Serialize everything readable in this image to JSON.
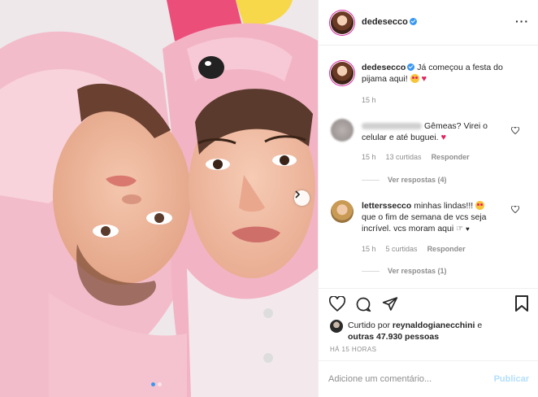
{
  "post": {
    "dots": 2,
    "active_dot": 0
  },
  "header": {
    "username": "dedesecco",
    "more_icon": "more-horizontal-icon"
  },
  "caption": {
    "username": "dedesecco",
    "text": "Já começou a festa do pijama aqui!",
    "time": "15 h"
  },
  "comments": [
    {
      "text": "Gêmeas? Virei o celular e até buguei.",
      "time": "15 h",
      "likes": "13 curtidas",
      "reply": "Responder",
      "view_replies": "Ver respostas (4)"
    },
    {
      "username": "letterssecco",
      "text_line1": "minhas lindas!!!",
      "text_line2": "que o fim de semana de vcs seja",
      "text_line3": "incrível. vcs moram aqui",
      "time": "15 h",
      "likes": "5 curtidas",
      "reply": "Responder",
      "view_replies": "Ver respostas (1)"
    }
  ],
  "likes": {
    "prefix": "Curtido por",
    "user": "reynaldogianecchini",
    "mid": "e",
    "others": "outras 47.930 pessoas"
  },
  "ago": "HÁ 15 HORAS",
  "add_comment": {
    "placeholder": "Adicione um comentário...",
    "publish": "Publicar"
  },
  "colors": {
    "accent": "#3897f0",
    "publish_disabled": "#b2dffc",
    "muted": "#8e8e8e",
    "heart": "#e0245e"
  }
}
